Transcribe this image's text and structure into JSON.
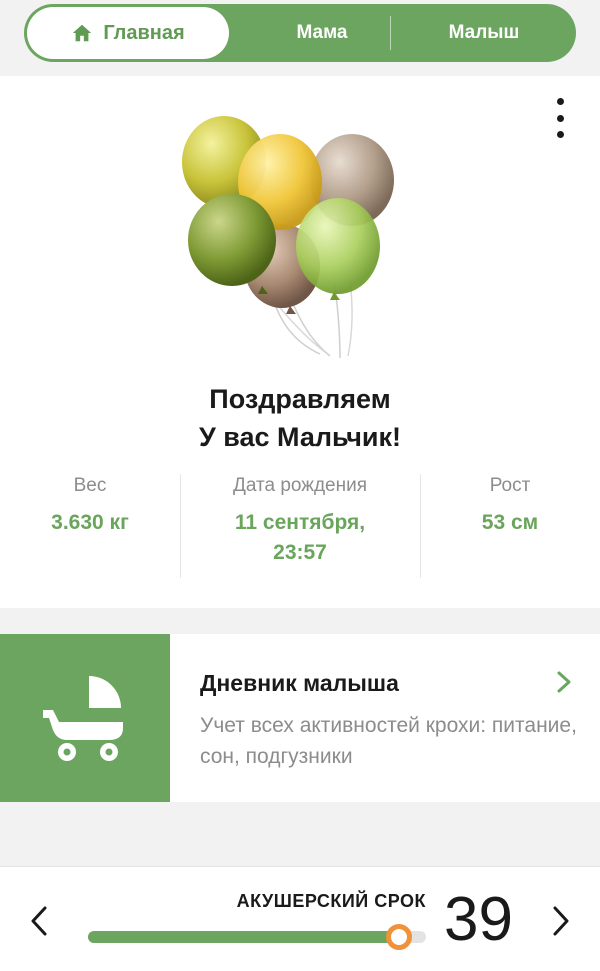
{
  "nav": {
    "tabs": [
      {
        "label": "Главная",
        "icon": "home-icon",
        "active": true
      },
      {
        "label": "Мама",
        "active": false
      },
      {
        "label": "Малыш",
        "active": false
      }
    ]
  },
  "congrats": {
    "line1": "Поздравляем",
    "line2": "У вас Мальчик!"
  },
  "stats": {
    "weight": {
      "label": "Вес",
      "value": "3.630 кг"
    },
    "birth": {
      "label": "Дата рождения",
      "value_line1": "11 сентября,",
      "value_line2": "23:57"
    },
    "height": {
      "label": "Рост",
      "value": "53 см"
    }
  },
  "diary": {
    "title": "Дневник малыша",
    "description": "Учет всех активностей крохи: питание, сон, подгузники",
    "icon": "stroller-icon"
  },
  "bottom": {
    "term_label": "АКУШЕРСКИЙ СРОК",
    "week": "39",
    "progress_fraction": 0.92
  },
  "colors": {
    "accent": "#6ca55f",
    "value_text": "#6aa55c",
    "thumb": "#f0923a",
    "muted_text": "#8c8c8c"
  }
}
